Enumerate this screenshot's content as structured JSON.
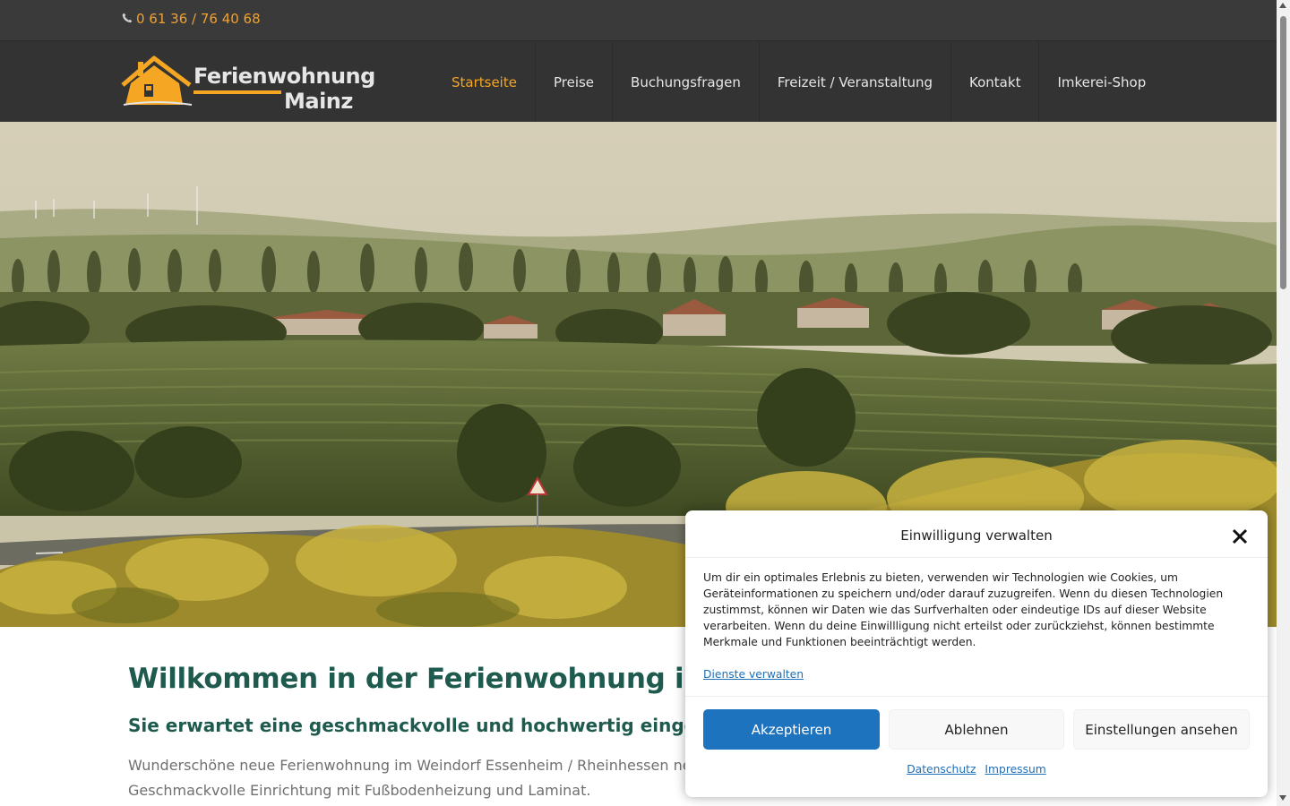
{
  "header": {
    "phone": "0 61 36 / 76 40 68",
    "phone_icon": "phone-icon",
    "logo": {
      "line1": "Ferienwohnung",
      "line2": "Mainz",
      "icon": "house-icon",
      "accent": "#f5a623"
    },
    "menu": [
      {
        "label": "Startseite",
        "active": true
      },
      {
        "label": "Preise"
      },
      {
        "label": "Buchungsfragen"
      },
      {
        "label": "Freizeit / Veranstaltung"
      },
      {
        "label": "Kontakt"
      },
      {
        "label": "Imkerei-Shop"
      }
    ]
  },
  "content": {
    "heading": "Willkommen in der Ferienwohnung im W",
    "subheading": "Sie erwartet eine geschmackvolle und hochwertig eingerichte",
    "paragraph_line1": "Wunderschöne neue Ferienwohnung im Weindorf Essenheim / Rheinhessen neben Main",
    "paragraph_line2": "Geschmackvolle Einrichtung mit Fußbodenheizung und Laminat."
  },
  "cookie_dialog": {
    "title": "Einwilligung verwalten",
    "close_icon": "close-icon",
    "text": "Um dir ein optimales Erlebnis zu bieten, verwenden wir Technologien wie Cookies, um Geräteinformationen zu speichern und/oder darauf zuzugreifen. Wenn du diesen Technologien zustimmst, können wir Daten wie das Surfverhalten oder eindeutige IDs auf dieser Website verarbeiten. Wenn du deine Einwillligung nicht erteilst oder zurückziehst, können bestimmte Merkmale und Funktionen beeinträchtigt werden.",
    "manage_link": "Dienste verwalten",
    "accept": "Akzeptieren",
    "deny": "Ablehnen",
    "settings": "Einstellungen ansehen",
    "privacy": "Datenschutz",
    "imprint": "Impressum"
  },
  "colors": {
    "topbar": "#3a3a3a",
    "navbar": "#333333",
    "accent": "#f5a623",
    "heading": "#1f5a4e",
    "primary_button": "#1e73be"
  }
}
